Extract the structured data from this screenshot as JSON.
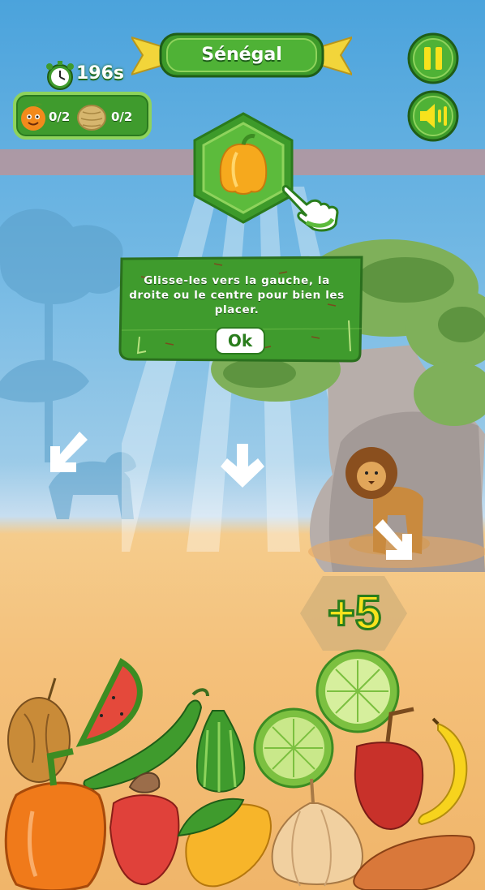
{
  "level": {
    "country": "Sénégal"
  },
  "timer": {
    "value": "196s",
    "icon": "stopwatch-icon"
  },
  "counters": [
    {
      "icon": "orange-character-icon",
      "text": "0/2"
    },
    {
      "icon": "tuber-icon",
      "text": "0/2"
    }
  ],
  "buttons": {
    "pause": "pause-icon",
    "sound": "sound-icon"
  },
  "target": {
    "item": "yellow-pepper-icon"
  },
  "tutorial": {
    "message": "Glisse-les vers la gauche, la droite ou le centre pour bien les placer.",
    "ok_label": "Ok"
  },
  "score_popup": "+5",
  "colors": {
    "panel_green": "#3f9b2d",
    "light_green": "#8ed35c",
    "dark_green": "#2a7d1d",
    "sky": "#4ba3dc",
    "sand": "#f4c07a",
    "score_yellow": "#f7e21c"
  }
}
